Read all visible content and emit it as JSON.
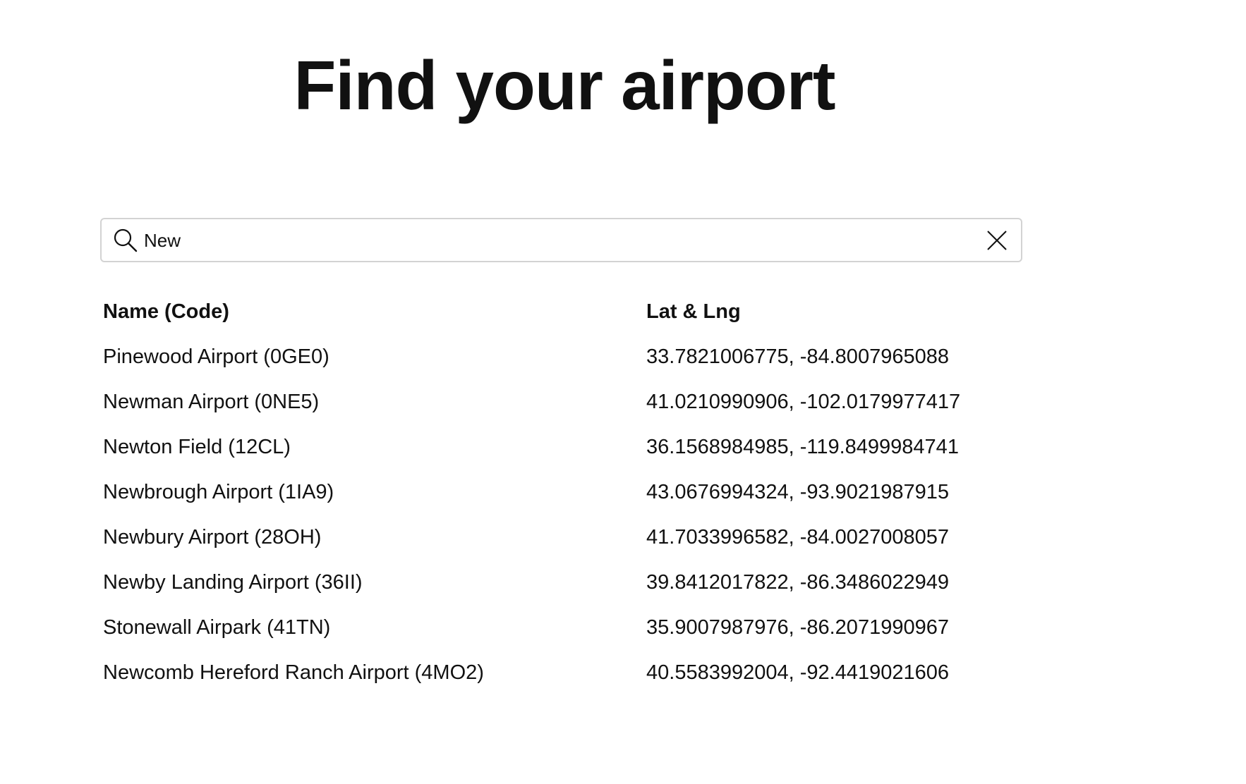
{
  "title": "Find your airport",
  "search": {
    "value": "New",
    "icon": "search-icon",
    "clear_icon": "close-icon"
  },
  "table": {
    "headers": {
      "name": "Name (Code)",
      "coords": "Lat & Lng"
    },
    "rows": [
      {
        "name": "Pinewood Airport (0GE0)",
        "coords": "33.7821006775, -84.8007965088"
      },
      {
        "name": "Newman Airport (0NE5)",
        "coords": "41.0210990906, -102.0179977417"
      },
      {
        "name": "Newton Field (12CL)",
        "coords": "36.1568984985, -119.8499984741"
      },
      {
        "name": "Newbrough Airport (1IA9)",
        "coords": "43.0676994324, -93.9021987915"
      },
      {
        "name": "Newbury Airport (28OH)",
        "coords": "41.7033996582, -84.0027008057"
      },
      {
        "name": "Newby Landing Airport (36II)",
        "coords": "39.8412017822, -86.3486022949"
      },
      {
        "name": "Stonewall Airpark (41TN)",
        "coords": "35.9007987976, -86.2071990967"
      },
      {
        "name": "Newcomb Hereford Ranch Airport (4MO2)",
        "coords": "40.5583992004, -92.4419021606"
      }
    ]
  }
}
